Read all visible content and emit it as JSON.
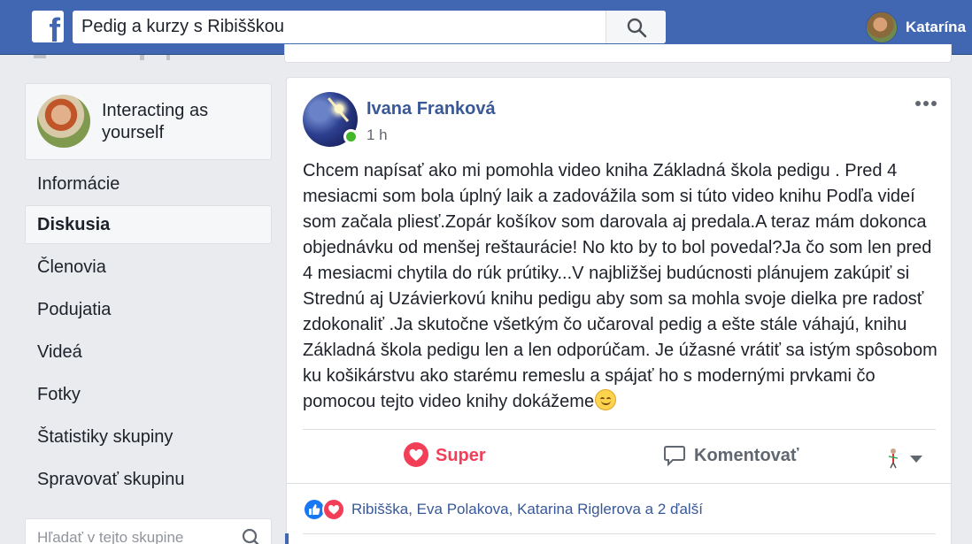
{
  "topbar": {
    "search_value": "Pedig a kurzy s Ribišškou",
    "user_name": "Katarína"
  },
  "sidebar": {
    "interacting_label": "Interacting as yourself",
    "items": [
      {
        "label": "Informácie"
      },
      {
        "label": "Diskusia",
        "active": true
      },
      {
        "label": "Členovia"
      },
      {
        "label": "Podujatia"
      },
      {
        "label": "Videá"
      },
      {
        "label": "Fotky"
      },
      {
        "label": "Štatistiky skupiny"
      },
      {
        "label": "Spravovať skupinu"
      }
    ],
    "group_search_placeholder": "Hľadať v tejto skupine"
  },
  "post": {
    "author": "Ivana Franková",
    "time": "1 h",
    "text": "Chcem napísať ako mi pomohla video kniha Základná škola pedigu . Pred 4 mesiacmi som bola úplný laik a zadovážila som si túto video knihu Podľa videí som začala pliesť.Zopár košíkov som darovala aj predala.A teraz mám dokonca objednávku od menšej reštaurácie! No kto by to bol povedal?Ja čo som len pred 4 mesiacmi chytila do rúk prútiky...V najbližšej budúcnosti plánujem zakúpiť si Strednú aj Uzávierkovú knihu pedigu aby som sa mohla svoje dielka pre radosť zdokonaliť .Ja skutočne všetkým čo učaroval pedig a ešte stále váhajú, knihu Základná škola pedigu len a len odporúčam. Je úžasné vrátiť sa istým spôsobom ku košikárstvu ako starému remeslu a spájať ho s modernými prvkami čo pomocou tejto video knihy dokážeme",
    "love_label": "Super",
    "comment_label": "Komentovať",
    "reactions_text": "Ribišška, Eva Polakova, Katarina Riglerova a 2 ďalší"
  },
  "colors": {
    "topbar": "#4267b2",
    "link": "#385898",
    "love": "#f33e58",
    "online": "#42b72a"
  }
}
